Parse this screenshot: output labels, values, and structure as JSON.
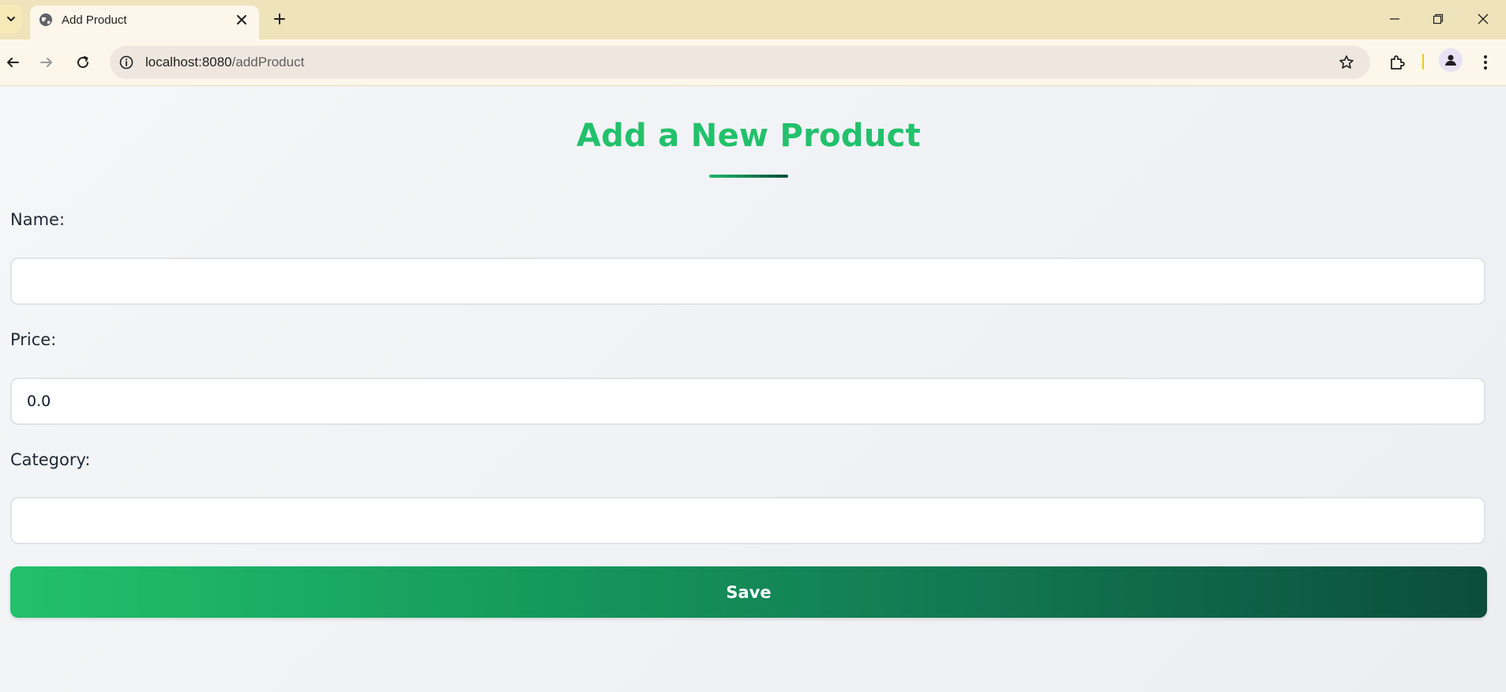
{
  "browser": {
    "tab": {
      "title": "Add Product",
      "favicon_icon": "globe-icon",
      "close_icon": "close-icon"
    },
    "new_tab_icon": "plus-icon",
    "window_controls": [
      "minimize-icon",
      "restore-icon",
      "close-icon"
    ],
    "address_bar": {
      "host": "localhost:8080",
      "path": "/addProduct"
    },
    "toolbar_icons": [
      "back-arrow-icon",
      "forward-arrow-icon",
      "reload-icon",
      "site-info-icon",
      "bookmark-star-icon",
      "extensions-icon",
      "profile-avatar-icon",
      "more-menu-icon"
    ]
  },
  "page": {
    "title": "Add a New Product",
    "form": {
      "name": {
        "label": "Name:",
        "value": ""
      },
      "price": {
        "label": "Price:",
        "value": "0.0"
      },
      "category": {
        "label": "Category:",
        "value": ""
      },
      "save_label": "Save"
    }
  },
  "colors": {
    "accent": "#22c16b",
    "accent_dark": "#0b4d3b",
    "tab_strip": "#efe3bb"
  }
}
